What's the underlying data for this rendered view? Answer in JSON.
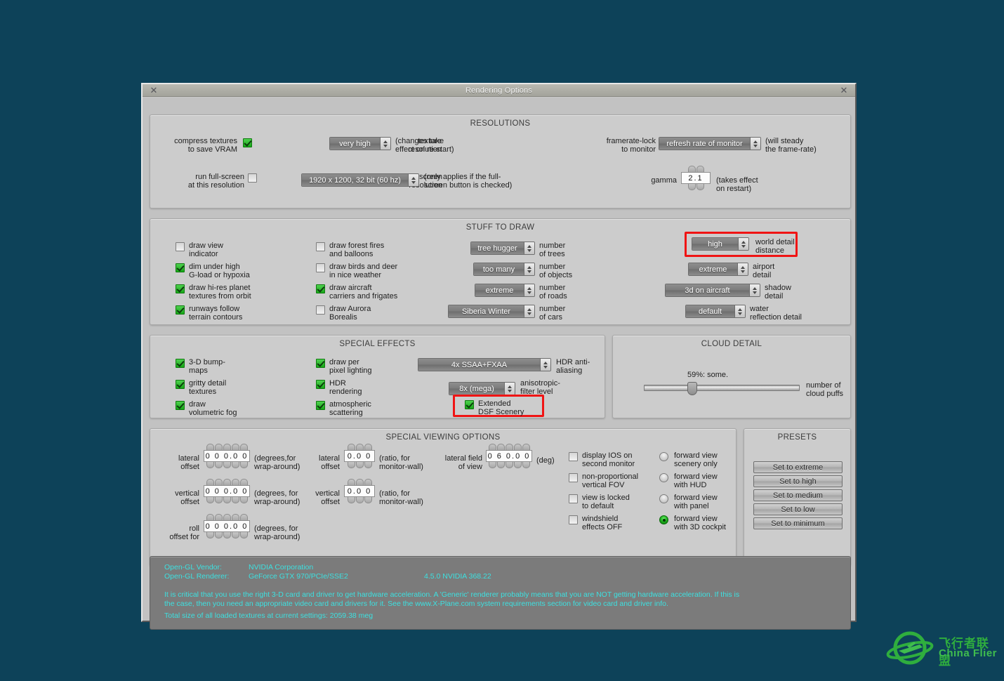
{
  "window": {
    "title": "Rendering Options",
    "close_left": "✕",
    "close_right": "✕"
  },
  "resolutions": {
    "title": "RESOLUTIONS",
    "compress_label": "compress textures\nto save VRAM",
    "compress_checked": true,
    "texture_res_label": "texture\nresolution",
    "texture_res_value": "very high",
    "texture_res_note": "(changes take\neffect on re-start)",
    "framerate_label": "framerate-lock\nto monitor",
    "framerate_value": "refresh rate of monitor",
    "framerate_note": "(will steady\nthe frame-rate)",
    "fullscreen_label": "run full-screen\nat this resolution",
    "fullscreen_checked": false,
    "screen_res_label": "screen\nresolution",
    "screen_res_value": "1920 x 1200, 32 bit (60 hz)",
    "screen_res_note": "(only applies if the full-\nscreen button is checked)",
    "gamma_label": "gamma",
    "gamma_value": "2.1",
    "gamma_note": "(takes effect\non restart)"
  },
  "stuff_to_draw": {
    "title": "STUFF TO DRAW",
    "col1": [
      {
        "label": "draw view\nindicator",
        "checked": false
      },
      {
        "label": "dim under high\nG-load or hypoxia",
        "checked": true
      },
      {
        "label": "draw hi-res planet\ntextures from orbit",
        "checked": true
      },
      {
        "label": "runways follow\nterrain contours",
        "checked": true
      }
    ],
    "col2": [
      {
        "label": "draw forest fires\nand balloons",
        "checked": false
      },
      {
        "label": "draw birds and deer\nin nice weather",
        "checked": false
      },
      {
        "label": "draw aircraft\ncarriers and frigates",
        "checked": true
      },
      {
        "label": "draw Aurora\nBorealis",
        "checked": false
      }
    ],
    "col3": [
      {
        "value": "tree hugger",
        "label": "number\nof trees"
      },
      {
        "value": "too many",
        "label": "number\nof objects"
      },
      {
        "value": "extreme",
        "label": "number\nof roads"
      },
      {
        "value": "Siberia Winter",
        "label": "number\nof cars"
      }
    ],
    "col4": [
      {
        "value": "high",
        "label": "world detail\ndistance",
        "highlighted": true
      },
      {
        "value": "extreme",
        "label": "airport\ndetail"
      },
      {
        "value": "3d on aircraft",
        "label": "shadow\ndetail"
      },
      {
        "value": "default",
        "label": "water\nreflection detail"
      }
    ]
  },
  "special_effects": {
    "title": "SPECIAL EFFECTS",
    "col1": [
      {
        "label": "3-D bump-\nmaps",
        "checked": true
      },
      {
        "label": "gritty detail\ntextures",
        "checked": true
      },
      {
        "label": "draw\nvolumetric fog",
        "checked": true
      }
    ],
    "col2": [
      {
        "label": "draw per\npixel lighting",
        "checked": true
      },
      {
        "label": "HDR\nrendering",
        "checked": true
      },
      {
        "label": "atmospheric\nscattering",
        "checked": true
      }
    ],
    "hdr_aa_value": "4x SSAA+FXAA",
    "hdr_aa_label": "HDR anti-\naliasing",
    "aniso_value": "8x (mega)",
    "aniso_label": "anisotropic-\nfilter level",
    "extended_dsf_label": "Extended\nDSF Scenery",
    "extended_dsf_checked": true,
    "extended_dsf_highlighted": true
  },
  "cloud_detail": {
    "title": "CLOUD DETAIL",
    "slider_text": "59%: some.",
    "slider_percent": 30,
    "slider_label": "number of\ncloud puffs"
  },
  "special_viewing": {
    "title": "SPECIAL VIEWING OPTIONS",
    "steppers": [
      {
        "label": "lateral\noffset",
        "value": "0 0 0.0 0",
        "note": "(degrees,for\nwrap-around)",
        "digits": 5
      },
      {
        "label": "vertical\noffset",
        "value": "0 0 0.0 0",
        "note": "(degrees, for\nwrap-around)",
        "digits": 5
      },
      {
        "label": "roll\noffset for",
        "value": "0 0 0.0 0",
        "note": "(degrees, for\nwrap-around)",
        "digits": 5
      },
      {
        "label": "lateral\noffset",
        "value": "0.0 0",
        "note": "(ratio, for\nmonitor-wall)",
        "digits": 3
      },
      {
        "label": "vertical\noffset",
        "value": "0.0 0",
        "note": "(ratio, for\nmonitor-wall)",
        "digits": 3
      },
      {
        "label": "lateral field\nof view",
        "value": "0 6 0.0 0",
        "note": "(deg)",
        "digits": 5
      }
    ],
    "checkboxes": [
      {
        "label": "display IOS on\nsecond monitor",
        "checked": false
      },
      {
        "label": "non-proportional\nvertical FOV",
        "checked": false
      },
      {
        "label": "view is locked\nto default",
        "checked": false
      },
      {
        "label": "windshield\neffects OFF",
        "checked": false
      }
    ],
    "radios": [
      {
        "label": "forward view\nscenery only",
        "selected": false
      },
      {
        "label": "forward view\nwith HUD",
        "selected": false
      },
      {
        "label": "forward view\nwith panel",
        "selected": false
      },
      {
        "label": "forward view\nwith 3D cockpit",
        "selected": true
      }
    ]
  },
  "presets": {
    "title": "PRESETS",
    "buttons": [
      "Set to extreme",
      "Set to high",
      "Set to medium",
      "Set to low",
      "Set to minimum"
    ]
  },
  "opengl": {
    "vendor_label": "Open-GL Vendor:",
    "vendor_value": "NVIDIA Corporation",
    "renderer_label": "Open-GL Renderer:",
    "renderer_value": "GeForce GTX 970/PCIe/SSE2",
    "version_value": "4.5.0 NVIDIA 368.22",
    "warning": "It is critical that you use the right 3-D card and driver to get hardware acceleration. A 'Generic' renderer probably means that you are NOT getting hardware acceleration. If this is\nthe case, then you need an appropriate video card and drivers for it. See the www.X-Plane.com system requirements section for video card and driver info.",
    "texture_total": "Total size of all loaded textures at current settings: 2059.38 meg"
  },
  "watermark": {
    "cn": "飞行者联盟",
    "en": "China Flier",
    "color": "#2fae3e"
  }
}
